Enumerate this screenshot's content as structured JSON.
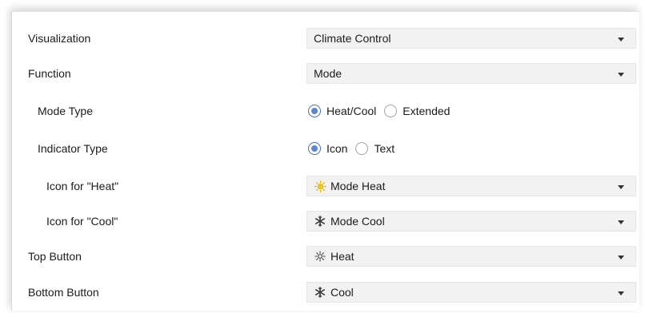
{
  "rows": [
    {
      "label": "Visualization",
      "value": "Climate Control"
    },
    {
      "label": "Function",
      "value": "Mode"
    },
    {
      "label": "Mode Type",
      "options": [
        "Heat/Cool",
        "Extended"
      ],
      "selected": "Heat/Cool"
    },
    {
      "label": "Indicator Type",
      "options": [
        "Icon",
        "Text"
      ],
      "selected": "Icon"
    },
    {
      "label": "Icon for \"Heat\"",
      "value": "Mode Heat",
      "icon": "sun-icon",
      "icon_color": "#f2c81b"
    },
    {
      "label": "Icon for \"Cool\"",
      "value": "Mode Cool",
      "icon": "snowflake-icon"
    },
    {
      "label": "Top Button",
      "value": "Heat",
      "icon": "heat-icon"
    },
    {
      "label": "Bottom Button",
      "value": "Cool",
      "icon": "snowflake-icon"
    }
  ],
  "colors": {
    "dropdown_bg": "#f2f2f2",
    "radio_selected": "#5b86c8"
  }
}
